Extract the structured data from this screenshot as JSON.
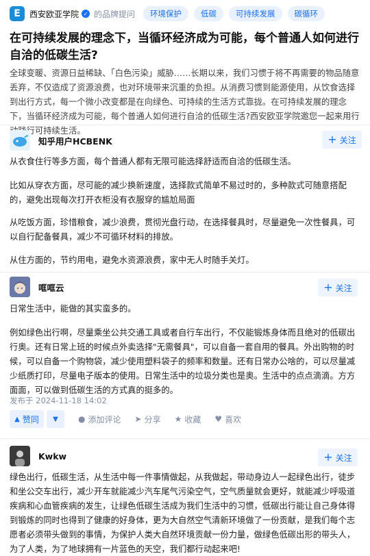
{
  "header": {
    "logo_letter": "E",
    "org_name": "西安欧亚学院",
    "subtitle": "的品牌提问",
    "tags": [
      "环境保护",
      "低碳",
      "可持续发展",
      "碳循环"
    ]
  },
  "question": {
    "title": "在可持续发展的理念下，当循环经济成为可能，每个普通人如何进行自洽的低碳生活?",
    "description": "全球变暖、资源日益稀缺、「白色污染」威胁……长期以来，我们习惯于将不再需要的物品随意丢弃，不仅造成了资源浪费，也对环境带来沉重的负担。从消费习惯到能源使用，从饮食选择到出行方式，每一个微小改变都是在向绿色、可持续的生活方式靠拢。在可持续发展的理念下，当循环经济成为可能，每个普通人如何进行自洽的低碳生活?西安欧亚学院邀您一起来用行动践行可持续生活。"
  },
  "follow_label": "关注",
  "answers": [
    {
      "author": "知乎用户HCBENK",
      "paragraphs": [
        "从衣食住行等多方面，每个普通人都有无限可能选择舒适而自洽的低碳生活。",
        "比如从穿衣方面，尽可能的减少换新速度，选择款式简单不易过时的，多种款式可随意搭配的，避免出现每次打开衣柜没有衣服穿的尴尬局面",
        "从吃饭方面，珍惜粮食，减少浪费，贯彻光盘行动，在选择餐具时，尽量避免一次性餐具，可以自行配备餐具，减少不可循环材料的排放。",
        "从住方面的，节约用电，避免水资源浪费，家中无人时随手关灯。"
      ]
    },
    {
      "author": "哐哐云",
      "paragraphs": [
        "日常生活中，能做的其实蛮多的。",
        "例如绿色出行啊，尽量乘坐公共交通工具或者自行车出行，不仅能锻炼身体而且绝对的低碳出行奥。还有日常上班的时候点外卖选择\"无需餐具\"，可以自备一套自用的餐具。外出购物的时候，可以自备一个购物袋，减少使用塑料袋子的频率和数量。还有日常办公啥的，可以尽量减少纸质打印，尽量电子版本的使用。日常生活中的垃圾分类也是奥。生活中的点点滴滴。方方面面，可以做到低碳生活的方式真的挺多的。"
      ],
      "date": "发布于 2024-11-18 14:02",
      "actions": {
        "upvote": "赞同",
        "comment": "添加评论",
        "share": "分享",
        "favorite": "收藏",
        "like": "喜欢"
      }
    },
    {
      "author": "Kwkw",
      "paragraphs": [
        "绿色出行，低碳生活，从生活中每一件事情做起，从我做起，带动身边人一起绿色出行，徒步和坐公交车出行，减少开车就能减少汽车尾气污染空气，空气质量就会更好，就能减少呼吸道疾病和心血管疾病的发生，让绿色低碳生活成为我们生活中的习惯，低碳出行能让自己身体得到锻炼的同时也得到了健康的好身体，更为大自然空气清新环境做了一份贡献，是我们每个志愿者必须带头做到的事情，为保护人类大自然环境贡献一份力量，做绿色低碳出形的带头人，为了人类，为了地球拥有一片蓝色的天空，我们都行动起来吧!"
      ]
    }
  ]
}
